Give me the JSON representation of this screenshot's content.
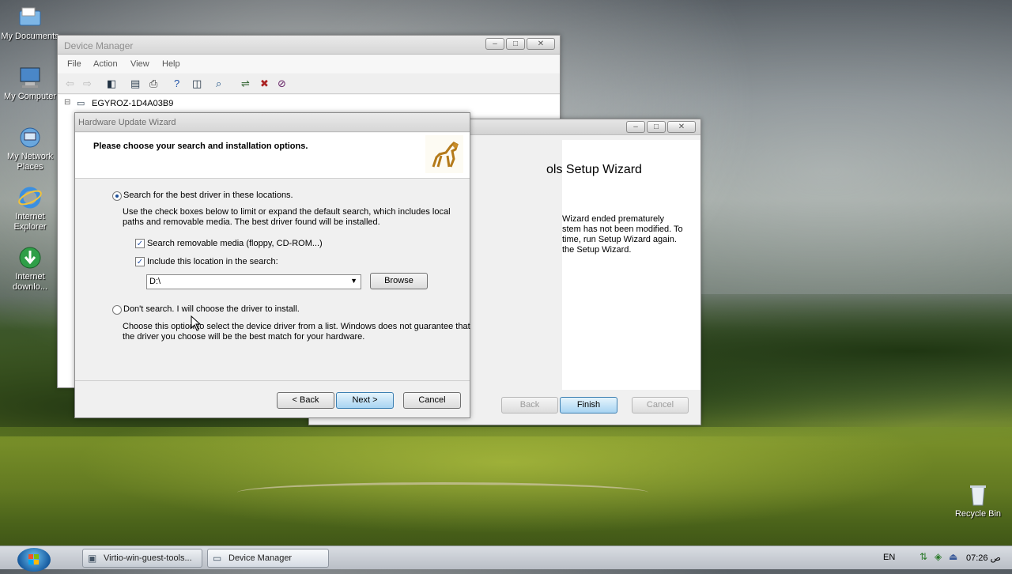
{
  "desktop": {
    "icons": [
      {
        "label": "My Documents",
        "icon": "my-documents-icon"
      },
      {
        "label": "My Computer",
        "icon": "my-computer-icon"
      },
      {
        "label": "My Network Places",
        "icon": "network-icon"
      },
      {
        "label": "Internet Explorer",
        "icon": "internet-explorer-icon"
      },
      {
        "label": "Internet downlo...",
        "icon": "download-manager-icon"
      },
      {
        "label": "Recycle Bin",
        "icon": "recycle-bin-icon"
      }
    ]
  },
  "device_manager": {
    "title": "Device Manager",
    "menu": [
      "File",
      "Action",
      "View",
      "Help"
    ],
    "tree_root": "EGYROZ-1D4A03B9"
  },
  "setup_wizard": {
    "heading_fragment": "ols Setup Wizard",
    "body_lines": [
      "Wizard ended prematurely",
      "stem has not been modified. To",
      "time, run Setup Wizard again.",
      " the Setup Wizard."
    ],
    "back": "Back",
    "finish": "Finish",
    "cancel": "Cancel"
  },
  "hardware_wizard": {
    "title": "Hardware Update Wizard",
    "heading": "Please choose your search and installation options.",
    "option1": "Search for the best driver in these locations.",
    "option1_desc_line1": "Use the check boxes below to limit or expand the default search, which includes local",
    "option1_desc_line2": "paths and removable media. The best driver found will be installed.",
    "check1": "Search removable media (floppy, CD-ROM...)",
    "check2": "Include this location in the search:",
    "location_value": "D:\\",
    "browse": "Browse",
    "option2": "Don't search. I will choose the driver to install.",
    "option2_desc_line1": "Choose this option to select the device driver from a list.  Windows does not guarantee that",
    "option2_desc_line2": "the driver you choose will be the best match for your hardware.",
    "back": "< Back",
    "next": "Next >",
    "cancel": "Cancel"
  },
  "taskbar": {
    "tasks": [
      "Virtio-win-guest-tools...",
      "Device Manager"
    ],
    "language": "EN",
    "clock": "07:26 ص"
  }
}
